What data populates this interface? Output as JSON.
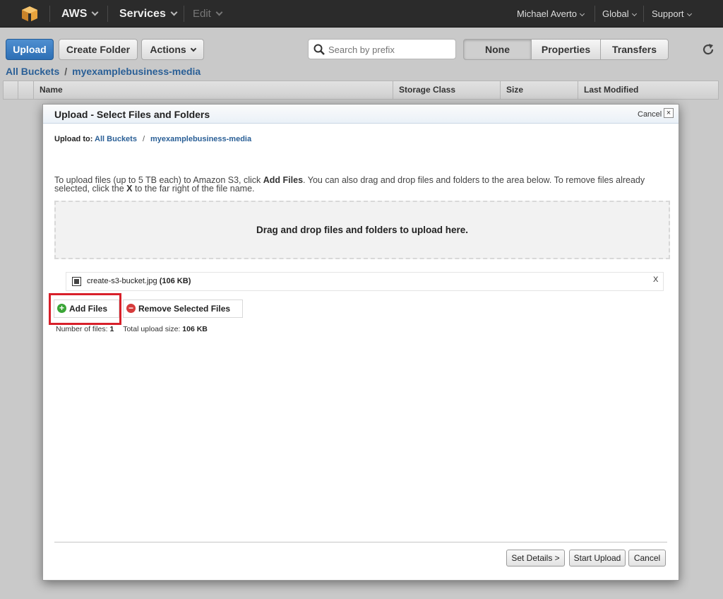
{
  "nav": {
    "brand": "AWS",
    "services": "Services",
    "edit": "Edit",
    "user": "Michael Averto",
    "region": "Global",
    "support": "Support"
  },
  "toolbar": {
    "upload": "Upload",
    "create_folder": "Create Folder",
    "actions": "Actions",
    "search_placeholder": "Search by prefix",
    "view_tabs": [
      "None",
      "Properties",
      "Transfers"
    ],
    "active_tab": "None"
  },
  "breadcrumb": {
    "root": "All Buckets",
    "separator": "/",
    "bucket": "myexamplebusiness-media"
  },
  "table": {
    "columns": [
      "Name",
      "Storage Class",
      "Size",
      "Last Modified"
    ]
  },
  "dialog": {
    "title": "Upload - Select Files and Folders",
    "cancel_link": "Cancel",
    "close_glyph": "×",
    "upload_to_label": "Upload to:",
    "upload_to_root": "All Buckets",
    "upload_to_separator": "/",
    "upload_to_bucket": "myexamplebusiness-media",
    "instructions": {
      "part1": "To upload files (up to 5 TB each) to Amazon S3, click ",
      "add_files_emph": "Add Files",
      "part2": ". You can also drag and drop files and folders to the area below. To remove files already selected, click the ",
      "x_emph": "X",
      "part3": " to the far right of the file name."
    },
    "dropzone_text": "Drag and drop files and folders to upload here.",
    "file": {
      "name": "create-s3-bucket.jpg",
      "size": "(106 KB)",
      "remove": "X"
    },
    "add_files_label": "Add Files",
    "remove_selected_label": "Remove Selected Files",
    "stats": {
      "count_label": "Number of files:",
      "count_value": "1",
      "size_label": "Total upload size:",
      "size_value": "106 KB"
    },
    "buttons": {
      "set_details": "Set Details >",
      "start_upload": "Start Upload",
      "cancel": "Cancel"
    }
  },
  "colors": {
    "nav_bg": "#2b2b2b",
    "upload_blue": "#2d6fb5",
    "link_blue": "#2a5f96",
    "highlight_red": "#d8202a",
    "add_icon_green": "#3aa536",
    "remove_icon_red": "#d63b3b"
  }
}
